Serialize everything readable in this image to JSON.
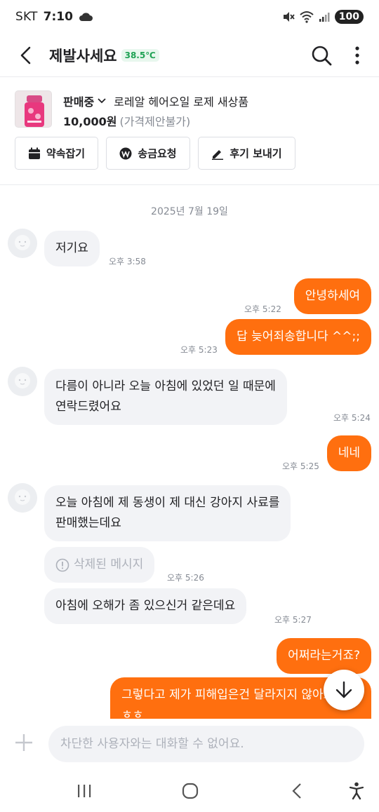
{
  "status_bar": {
    "carrier": "SKT",
    "time": "7:10",
    "battery": "100"
  },
  "header": {
    "title": "제발사세요",
    "manner_temp": "38.5℃"
  },
  "product": {
    "state": "판매중",
    "name": "로레알 헤어오일 로제 새상품",
    "price": "10,000원",
    "price_note": "(가격제안불가)",
    "actions": [
      {
        "label": "약속잡기",
        "icon": "calendar-icon"
      },
      {
        "label": "송금요청",
        "icon": "won-icon"
      },
      {
        "label": "후기 보내기",
        "icon": "pencil-icon"
      }
    ]
  },
  "chat": {
    "date": "2025년 7월 19일",
    "messages": [
      {
        "from": "other",
        "text": "저기요",
        "time": "오후 3:58"
      },
      {
        "from": "me",
        "text": "안녕하세여",
        "time": "오후 5:22"
      },
      {
        "from": "me",
        "text": "답 늦어죄송합니다 ^^;;",
        "time": "오후 5:23"
      },
      {
        "from": "other",
        "lines": [
          "다름이 아니라 오늘 아침에 있었던 일 때문에",
          "연락드렸어요"
        ],
        "time": "오후 5:24"
      },
      {
        "from": "me",
        "text": "네네",
        "time": "오후 5:25"
      },
      {
        "from": "other",
        "lines": [
          "오늘 아침에 제 동생이 제 대신 강아지 사료를",
          "판매했는데요"
        ]
      },
      {
        "from": "other",
        "deleted": true,
        "text": "삭제된 메시지",
        "time": "오후 5:26"
      },
      {
        "from": "other",
        "text": "아침에 오해가 좀 있으신거 같은데요",
        "time": "오후 5:27"
      },
      {
        "from": "me",
        "text": "어쩌라는거죠?"
      },
      {
        "from": "me",
        "lines": [
          "그렇다고 제가 피해입은건 달라지지 않아요 ㅎㅎ",
          "ㅎㅎ"
        ]
      }
    ]
  },
  "input": {
    "placeholder": "차단한 사용자와는 대화할 수 없어요."
  },
  "colors": {
    "accent": "#ff6f0f",
    "incoming_bubble": "#f2f3f6",
    "temp_green": "#1fa254"
  }
}
